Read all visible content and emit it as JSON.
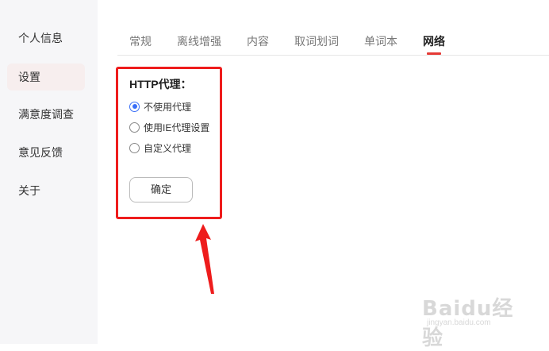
{
  "sidebar": {
    "items": [
      {
        "label": "个人信息",
        "active": false
      },
      {
        "label": "设置",
        "active": true
      },
      {
        "label": "满意度调查",
        "active": false
      },
      {
        "label": "意见反馈",
        "active": false
      },
      {
        "label": "关于",
        "active": false
      }
    ]
  },
  "tabs": [
    {
      "label": "常规",
      "active": false
    },
    {
      "label": "离线增强",
      "active": false
    },
    {
      "label": "内容",
      "active": false
    },
    {
      "label": "取词划词",
      "active": false
    },
    {
      "label": "单词本",
      "active": false
    },
    {
      "label": "网络",
      "active": true
    }
  ],
  "proxy": {
    "title": "HTTP代理：",
    "options": [
      {
        "label": "不使用代理",
        "selected": true
      },
      {
        "label": "使用IE代理设置",
        "selected": false
      },
      {
        "label": "自定义代理",
        "selected": false
      }
    ],
    "confirm_label": "确定"
  },
  "colors": {
    "accent": "#e53935",
    "radio_selected": "#3a6ff7",
    "annotation_red": "#ee1c1c"
  },
  "watermark": {
    "main": "Baidu经验",
    "sub": "jingyan.baidu.com"
  }
}
